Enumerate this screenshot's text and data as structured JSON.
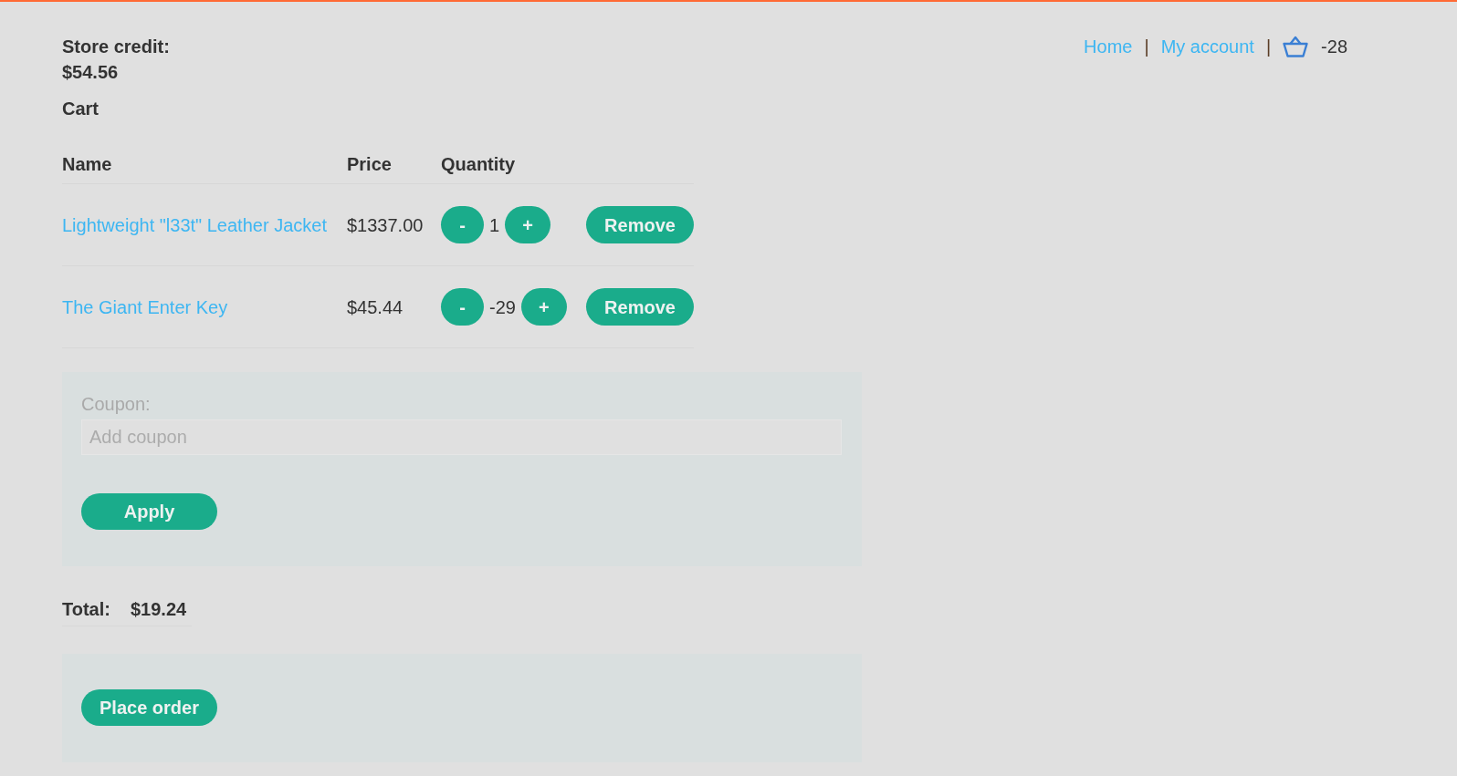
{
  "header": {
    "store_credit_label": "Store credit:",
    "store_credit_value": "$54.56",
    "nav": [
      {
        "kind": "link",
        "label": "Home"
      },
      {
        "kind": "separator",
        "label": "|"
      },
      {
        "kind": "link",
        "label": "My account"
      },
      {
        "kind": "separator",
        "label": "|"
      },
      {
        "kind": "cart",
        "label": "-28"
      }
    ]
  },
  "cart": {
    "title": "Cart",
    "columns": [
      "Name",
      "Price",
      "Quantity"
    ],
    "rows": [
      {
        "name": "Lightweight \"l33t\" Leather Jacket",
        "price": "$1337.00",
        "decrease": "-",
        "quantity": "1",
        "increase": "+",
        "remove": "Remove"
      },
      {
        "name": "The Giant Enter Key",
        "price": "$45.44",
        "decrease": "-",
        "quantity": "-29",
        "increase": "+",
        "remove": "Remove"
      }
    ]
  },
  "coupon": {
    "label": "Coupon:",
    "placeholder": "Add coupon",
    "button": "Apply"
  },
  "total": {
    "label": "Total:",
    "value": "$19.24"
  },
  "order": {
    "button": "Place order"
  }
}
